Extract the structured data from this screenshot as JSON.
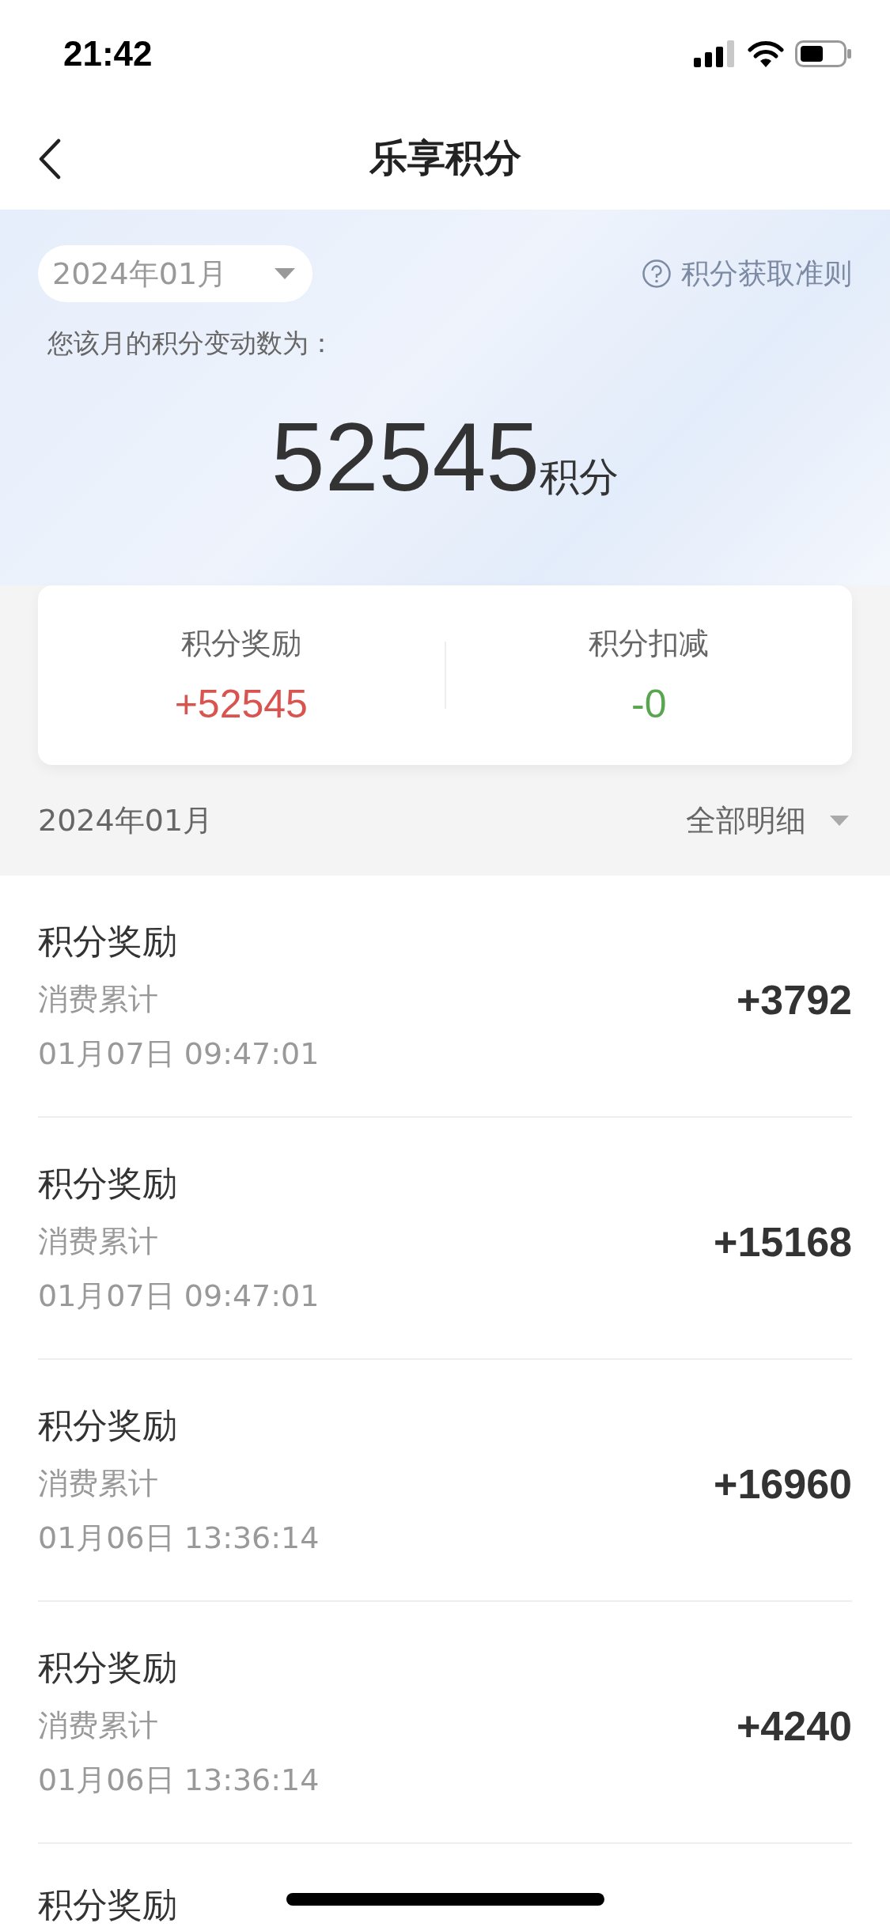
{
  "status_bar": {
    "time": "21:42"
  },
  "nav": {
    "title": "乐享积分"
  },
  "header": {
    "month": "2024年01月",
    "rules_link": "积分获取准则",
    "caption": "您该月的积分变动数为：",
    "total": "52545",
    "unit": "积分"
  },
  "summary": [
    {
      "label": "积分奖励",
      "value": "+52545",
      "color": "#d9534f"
    },
    {
      "label": "积分扣减",
      "value": "-0",
      "color": "#5aa54f"
    }
  ],
  "list_header": {
    "month": "2024年01月",
    "filter": "全部明细"
  },
  "records": [
    {
      "title": "积分奖励",
      "source": "消费累计",
      "time": "01月07日 09:47:01",
      "amount": "+3792"
    },
    {
      "title": "积分奖励",
      "source": "消费累计",
      "time": "01月07日 09:47:01",
      "amount": "+15168"
    },
    {
      "title": "积分奖励",
      "source": "消费累计",
      "time": "01月06日 13:36:14",
      "amount": "+16960"
    },
    {
      "title": "积分奖励",
      "source": "消费累计",
      "time": "01月06日 13:36:14",
      "amount": "+4240"
    },
    {
      "title": "积分奖励"
    }
  ]
}
